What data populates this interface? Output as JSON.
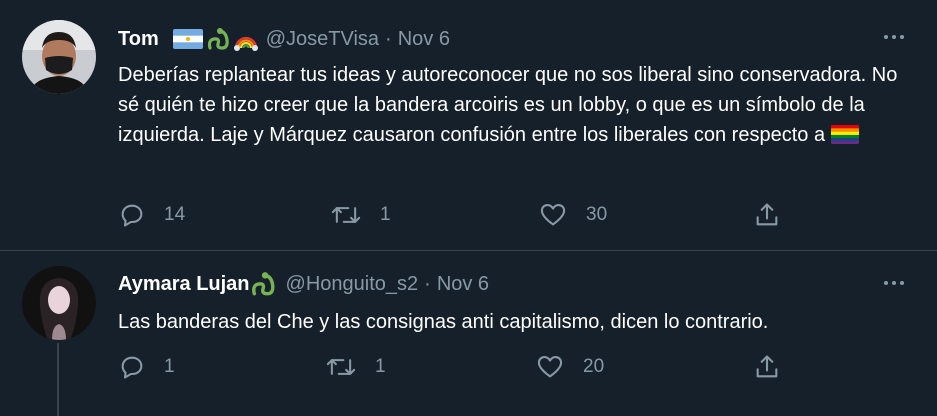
{
  "tweets": [
    {
      "name": "Tom",
      "handle": "@JoseTVisa",
      "dot": "·",
      "date": "Nov 6",
      "text": "Deberías replantear tus ideas y autoreconocer que no sos liberal sino conservadora. No sé quién te hizo creer que la bandera arcoiris es un lobby, o que es un símbolo de la izquierda. Laje y Márquez causaron confusión entre los liberales con respecto a",
      "name_emojis": [
        "argentina-flag-emoji",
        "snake-emoji",
        "rainbow-emoji"
      ],
      "reply_count": "14",
      "retweet_count": "1",
      "like_count": "30"
    },
    {
      "name": "Aymara Lujan",
      "handle": "@Honguito_s2",
      "dot": "·",
      "date": "Nov 6",
      "text": "Las banderas del Che y las consignas anti capitalismo, dicen lo contrario.",
      "name_emojis": [
        "snake-emoji"
      ],
      "reply_count": "1",
      "retweet_count": "1",
      "like_count": "20"
    }
  ],
  "colors": {
    "background": "#15202b",
    "secondary_text": "#8899a6",
    "divider": "#38444d"
  }
}
